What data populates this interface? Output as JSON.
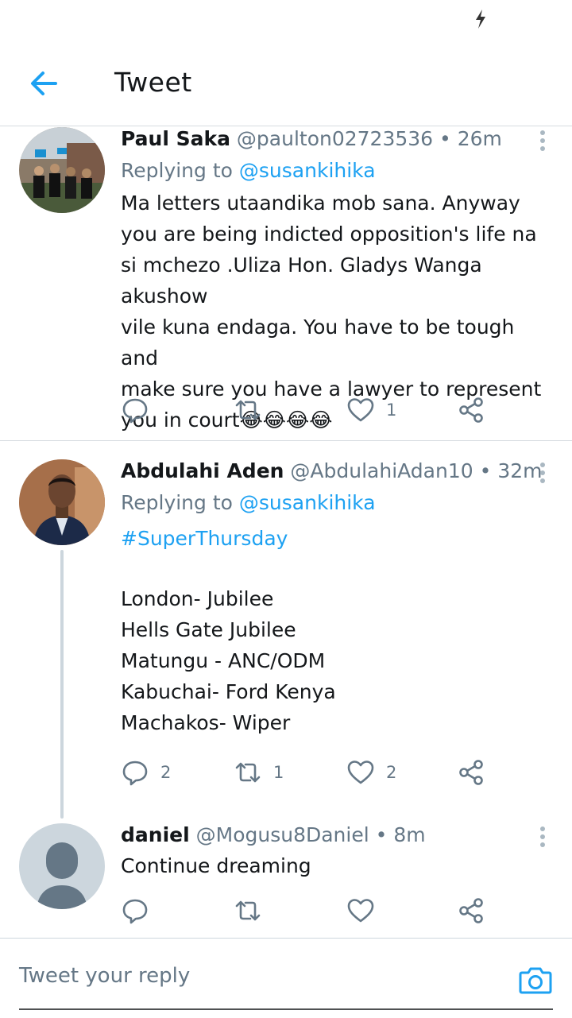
{
  "header": {
    "title": "Tweet"
  },
  "tweets": [
    {
      "name": "Paul Saka",
      "handle": "@paulton02723536",
      "separator": "•",
      "time": "26m",
      "replying_prefix": "Replying to",
      "replying_to": "@susankihika",
      "body": "Ma letters utaandika mob sana. Anyway\nyou are being indicted  opposition's life na\nsi mchezo .Uliza Hon. Gladys Wanga akushow\nvile kuna endaga. You have to be tough and\nmake sure you have a lawyer to represent\nyou in court😂😂😂😂",
      "counts": {
        "reply": "",
        "retweet": "",
        "like": "1"
      }
    },
    {
      "name": "Abdulahi Aden",
      "handle": "@AbdulahiAdan10",
      "separator": "•",
      "time": "32m",
      "replying_prefix": "Replying to",
      "replying_to": "@susankihika",
      "hashtag": "#SuperThursday",
      "body": "London- Jubilee\nHells Gate Jubilee\nMatungu - ANC/ODM\nKabuchai- Ford Kenya\nMachakos- Wiper",
      "counts": {
        "reply": "2",
        "retweet": "1",
        "like": "2"
      }
    },
    {
      "name": "daniel",
      "handle": "@Mogusu8Daniel",
      "separator": "•",
      "time": "8m",
      "body": "Continue dreaming",
      "counts": {
        "reply": "",
        "retweet": "",
        "like": ""
      }
    }
  ],
  "compose": {
    "placeholder": "Tweet your reply"
  },
  "colors": {
    "accent": "#1da1f2",
    "secondary_text": "#657786",
    "divider": "#d6dbe0"
  }
}
